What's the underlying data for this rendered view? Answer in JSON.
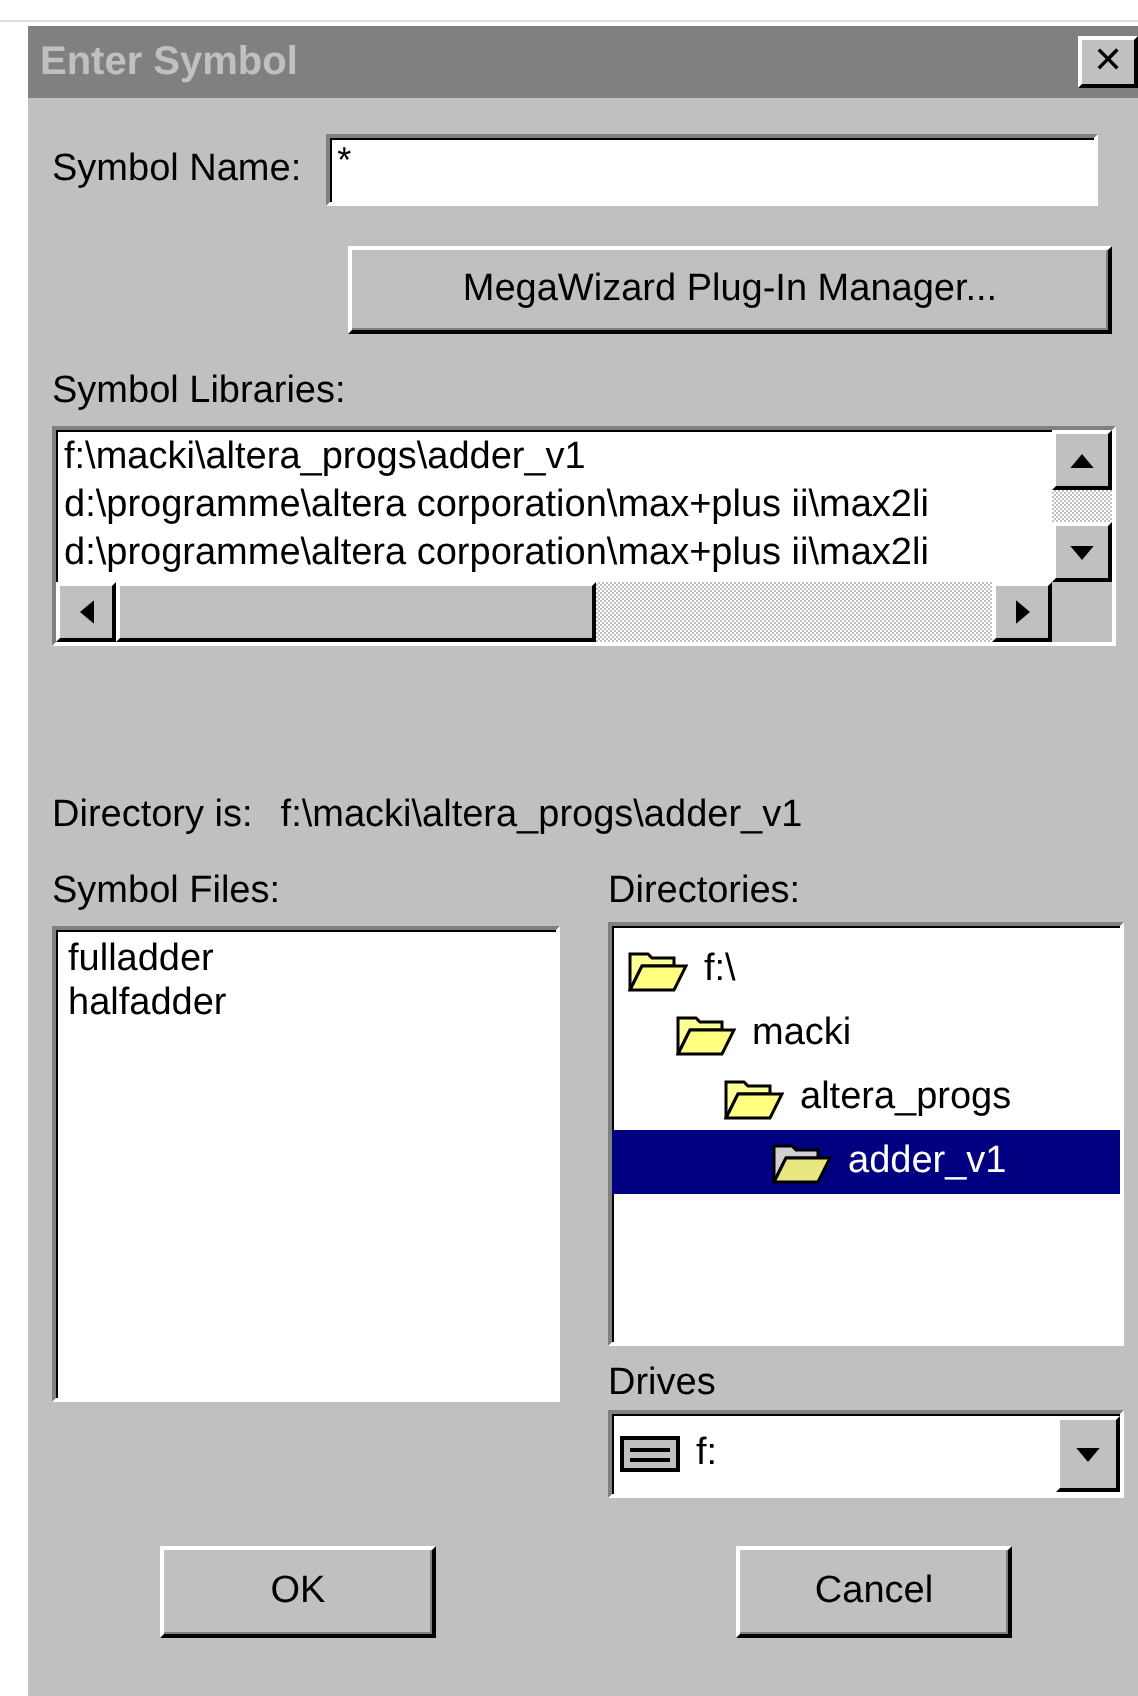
{
  "window": {
    "title": "Enter Symbol",
    "close": "✕"
  },
  "symbol_name": {
    "label": "Symbol Name:",
    "value": "*"
  },
  "megawizard_button": "MegaWizard Plug-In Manager...",
  "symbol_libraries": {
    "label": "Symbol Libraries:",
    "items": [
      {
        "text": "f:\\macki\\altera_progs\\adder_v1"
      },
      {
        "text": "d:\\programme\\altera corporation\\max+plus ii\\max2li"
      },
      {
        "text": "d:\\programme\\altera corporation\\max+plus ii\\max2li"
      }
    ]
  },
  "directory": {
    "label": "Directory is:",
    "value": "f:\\macki\\altera_progs\\adder_v1"
  },
  "symbol_files": {
    "label": "Symbol Files:",
    "items": [
      {
        "text": "fulladder",
        "selected": false
      },
      {
        "text": "halfadder",
        "selected": false
      }
    ]
  },
  "directories": {
    "label": "Directories:",
    "tree": [
      {
        "text": "f:\\",
        "selected": false,
        "children": [
          {
            "text": "macki",
            "selected": false,
            "children": [
              {
                "text": "altera_progs",
                "selected": false,
                "children": [
                  {
                    "text": "adder_v1",
                    "selected": true
                  }
                ]
              }
            ]
          }
        ]
      }
    ]
  },
  "drives": {
    "label": "Drives",
    "value": "f:"
  },
  "buttons": [
    {
      "label": "OK"
    },
    {
      "label": "Cancel"
    }
  ]
}
